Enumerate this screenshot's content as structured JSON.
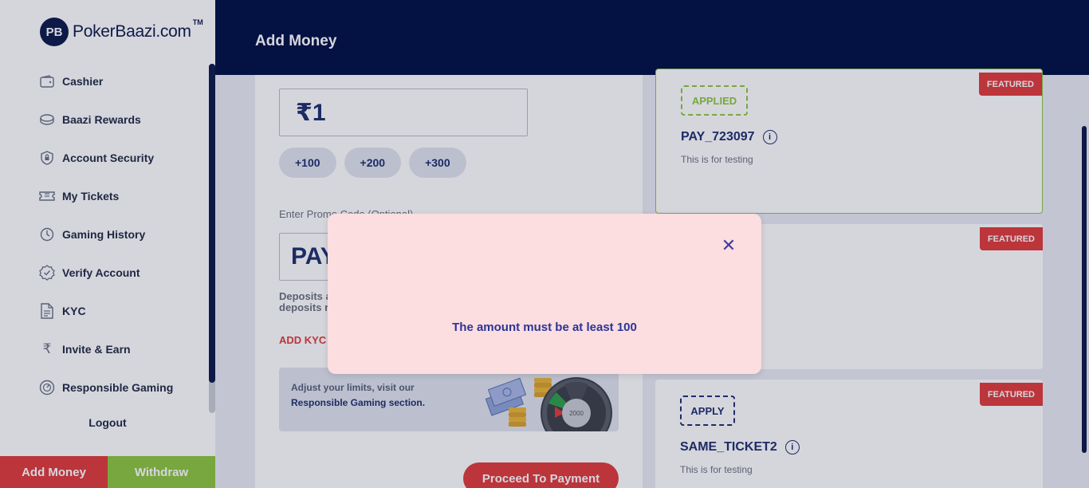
{
  "brand": {
    "logo_mark": "PB",
    "name": "PokerBaazi.com",
    "tm": "TM"
  },
  "sidebar": {
    "items": [
      {
        "label": "Cashier",
        "icon": "wallet-icon"
      },
      {
        "label": "Baazi Rewards",
        "icon": "coins-icon"
      },
      {
        "label": "Account Security",
        "icon": "shield-lock-icon"
      },
      {
        "label": "My Tickets",
        "icon": "ticket-icon"
      },
      {
        "label": "Gaming History",
        "icon": "clock-icon"
      },
      {
        "label": "Verify Account",
        "icon": "badge-check-icon"
      },
      {
        "label": "KYC",
        "icon": "document-icon"
      },
      {
        "label": "Invite & Earn",
        "icon": "rupee-icon"
      },
      {
        "label": "Responsible Gaming",
        "icon": "gauge-icon"
      }
    ],
    "logout": "Logout",
    "add_money": "Add Money",
    "withdraw": "Withdraw"
  },
  "header": {
    "title": "Add Money"
  },
  "form": {
    "amount_value": "₹1",
    "chips": [
      "+100",
      "+200",
      "+300"
    ],
    "promo_label": "Enter Promo Code (Optional)",
    "promo_value": "PAY",
    "deposit_note": "Deposits a deposits r",
    "kyc_link": "ADD KYC I",
    "rg_line1": "Adjust your limits, visit our",
    "rg_line2": "Responsible Gaming section.",
    "proceed": "Proceed To Payment"
  },
  "offers": [
    {
      "featured": "FEATURED",
      "tag": "APPLIED",
      "code": "PAY_723097",
      "desc": "This is for testing"
    },
    {
      "featured": "FEATURED"
    },
    {
      "featured": "FEATURED",
      "tag": "APPLY",
      "code": "SAME_TICKET2",
      "desc": "This is for testing"
    }
  ],
  "modal": {
    "message": "The amount must be at least 100"
  },
  "colors": {
    "navy": "#000f45",
    "red": "#e03b3b",
    "green": "#8dc63f",
    "modal_bg": "#fcdde0"
  }
}
